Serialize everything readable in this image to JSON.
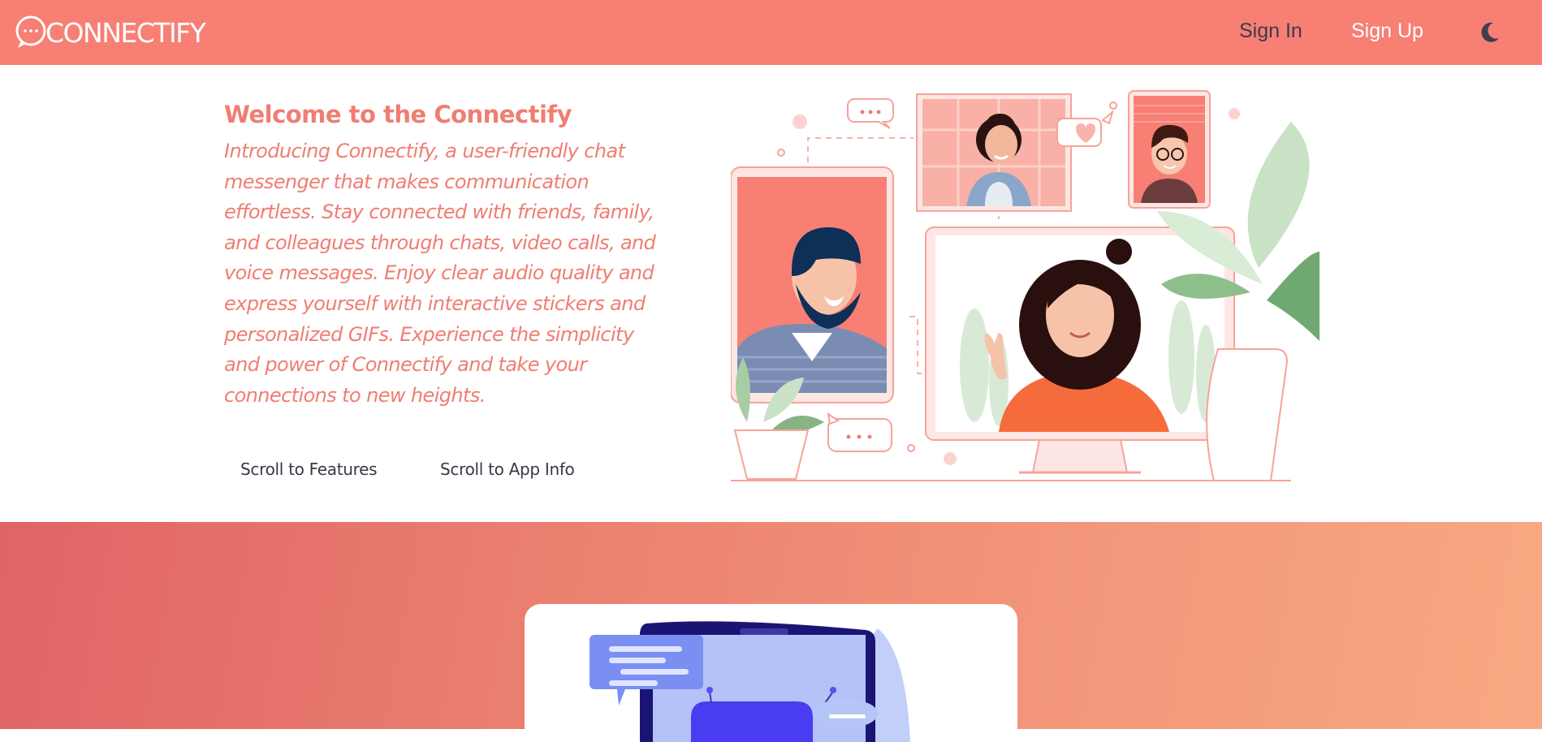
{
  "navbar": {
    "logo_text": "CONNECTIFY",
    "sign_in": "Sign In",
    "sign_up": "Sign Up",
    "theme_toggle_icon": "moon-icon"
  },
  "hero": {
    "title": "Welcome to the Connectify",
    "description": "Introducing Connectify, a user-friendly chat messenger that makes communication effortless. Stay connected with friends, family, and colleagues through chats, video calls, and voice messages. Enjoy clear audio quality and express yourself with interactive stickers and personalized GIFs. Experience the simplicity and power of Connectify and take your connections to new heights.",
    "buttons": {
      "features": "Scroll to Features",
      "app_info": "Scroll to App Info"
    }
  },
  "colors": {
    "brand": "#f77f74",
    "text_accent": "#f07d72",
    "gradient_start": "#e06466",
    "gradient_end": "#f8a982"
  }
}
